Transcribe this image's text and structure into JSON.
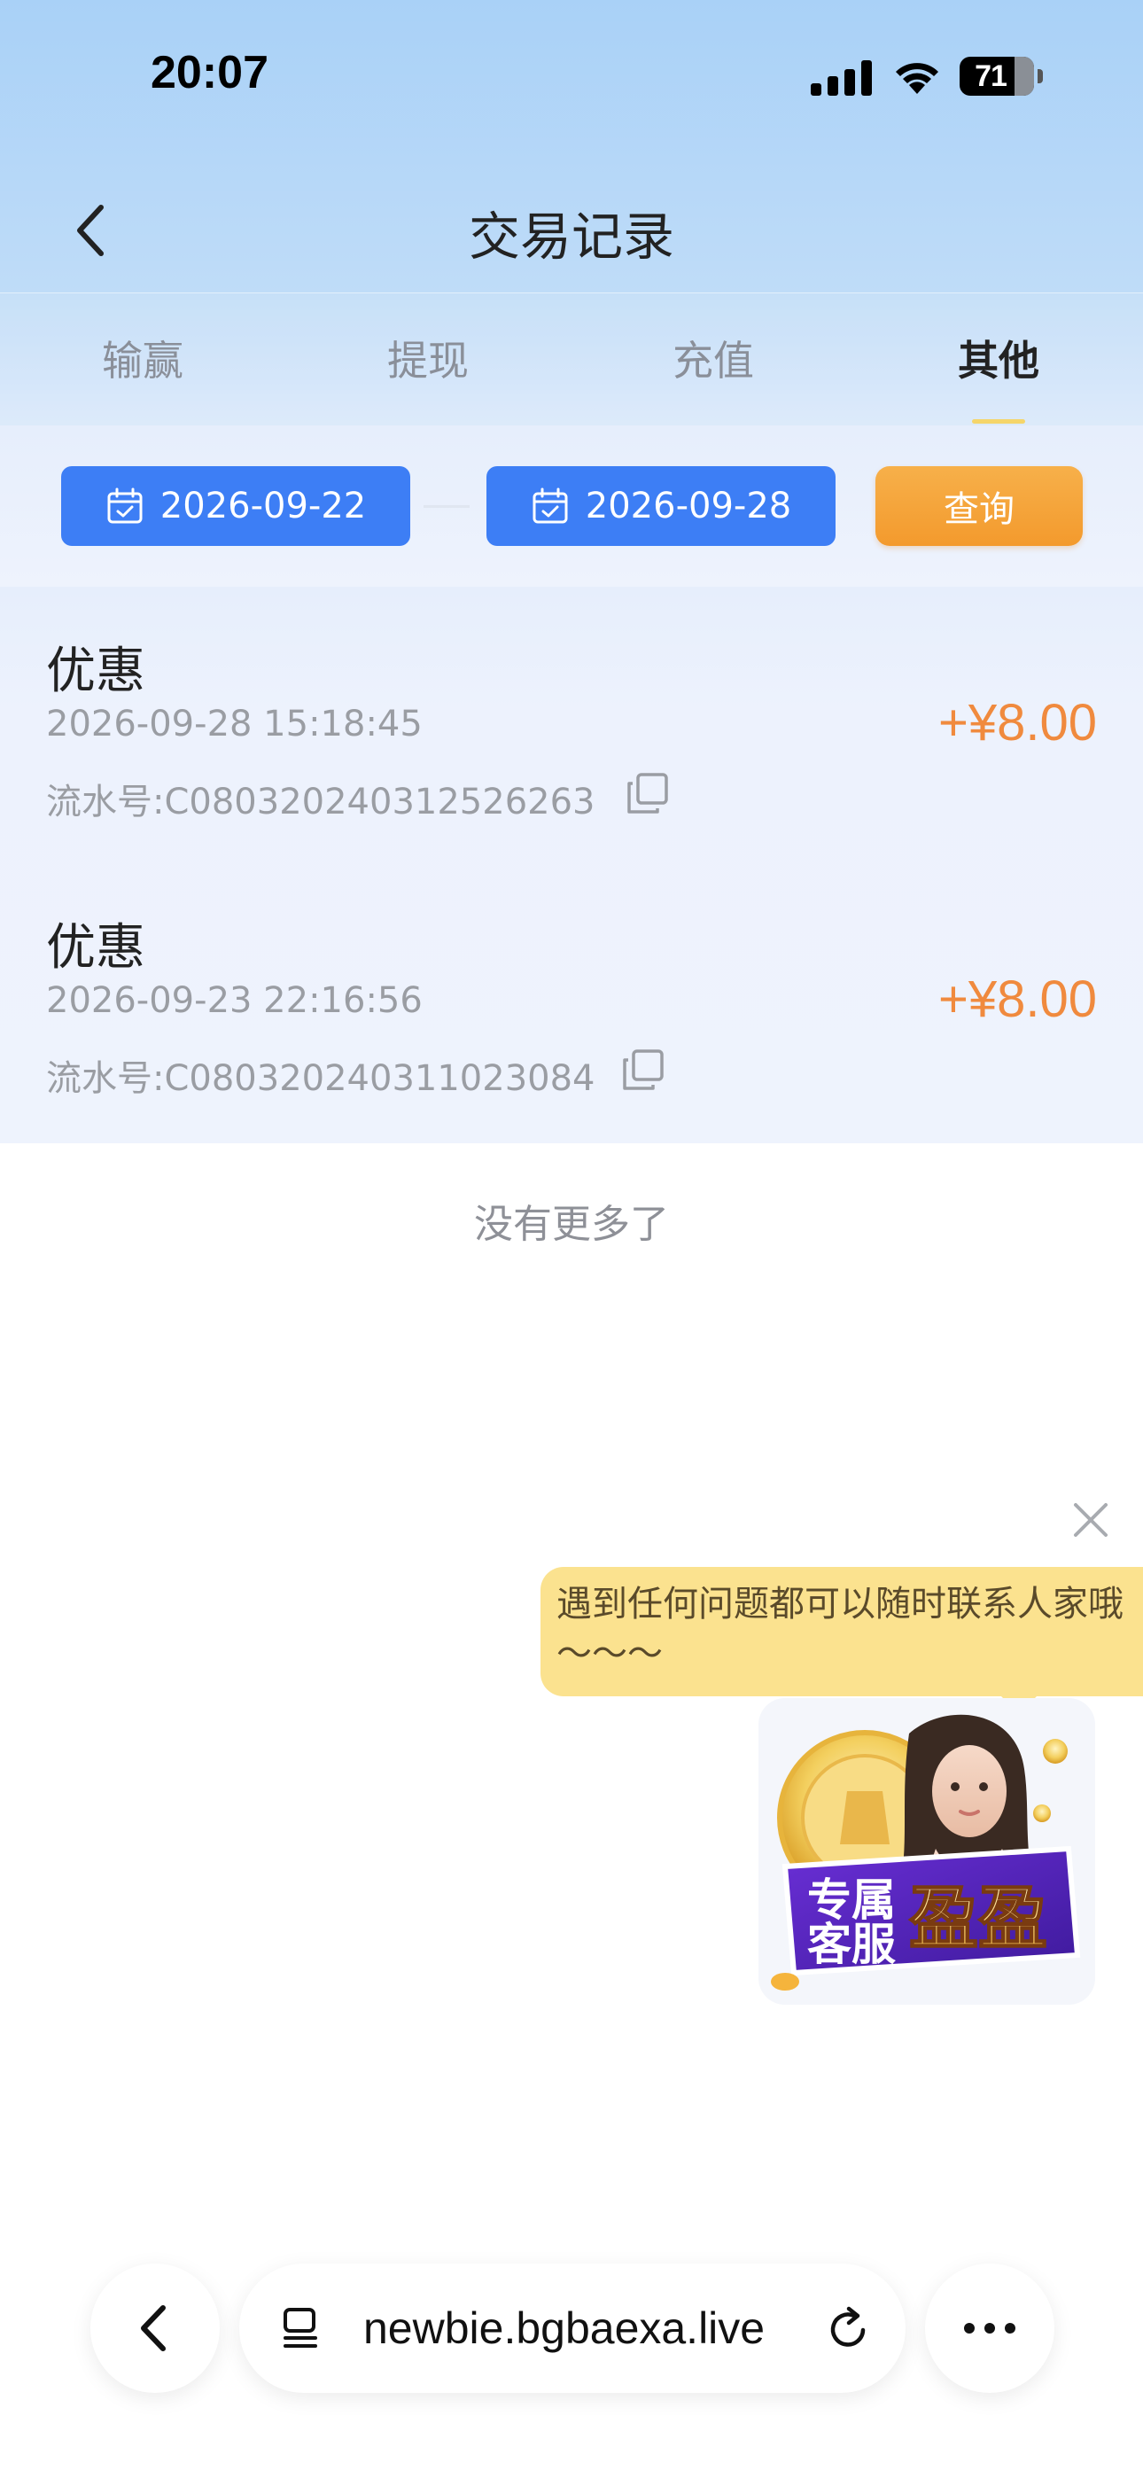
{
  "status_bar": {
    "time": "20:07",
    "battery": "71"
  },
  "header": {
    "title": "交易记录"
  },
  "tabs": [
    {
      "label": "输赢",
      "active": false
    },
    {
      "label": "提现",
      "active": false
    },
    {
      "label": "充值",
      "active": false
    },
    {
      "label": "其他",
      "active": true
    }
  ],
  "filter": {
    "start_date": "2026-09-22",
    "end_date": "2026-09-28",
    "query_label": "查询"
  },
  "transactions": [
    {
      "title": "优惠",
      "time": "2026-09-28 15:18:45",
      "serial": "流水号:C080320240312526263",
      "amount": "+¥8.00"
    },
    {
      "title": "优惠",
      "time": "2026-09-23 22:16:56",
      "serial": "流水号:C080320240311023084",
      "amount": "+¥8.00"
    }
  ],
  "list_footer": "没有更多了",
  "support": {
    "bubble_text": "遇到任何问题都可以随时联系人家哦～～～",
    "badge_line1": "专属",
    "badge_line2": "客服",
    "badge_name": "盈盈"
  },
  "browser": {
    "url": "newbie.bgbaexa.live"
  },
  "colors": {
    "accent_blue": "#3d7ef5",
    "accent_orange": "#f39a2d",
    "amount_orange": "#f08a3e",
    "bubble_yellow": "#fbe28f"
  },
  "icons": [
    "back-chevron-icon",
    "calendar-icon",
    "copy-icon",
    "close-icon",
    "reader-icon",
    "reload-icon",
    "more-icon",
    "signal-icon",
    "wifi-icon",
    "battery-icon"
  ]
}
